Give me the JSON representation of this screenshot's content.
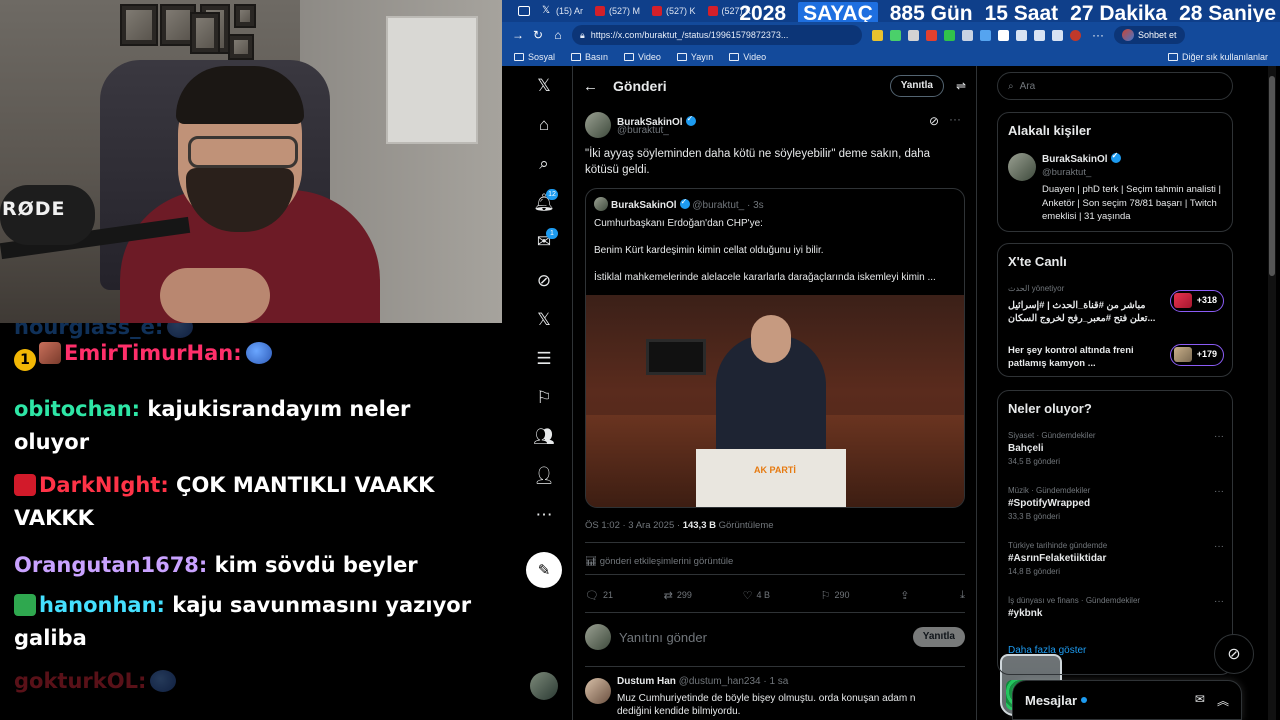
{
  "stream": {
    "mic_brand": "RØDE",
    "chat": [
      {
        "user": "hourglass_e:",
        "text": "",
        "color": "#2f8cff",
        "badges": [],
        "emote": true,
        "faded": true
      },
      {
        "user": "EmirTimurHan:",
        "text": "",
        "color": "#ff2f6a",
        "badges": [
          "num",
          "img"
        ],
        "badge_num": "1",
        "emote": true
      },
      {
        "user": "obitochan:",
        "text": "kajukisrandayım neler oluyor",
        "color": "#2ee6a6",
        "badges": []
      },
      {
        "user": "DarkNIght:",
        "text": "ÇOK MANTIKLI VAAKK VAKKK",
        "color": "#ff3347",
        "badges": [
          "red"
        ]
      },
      {
        "user": "Orangutan1678:",
        "text": "kim sövdü beyler",
        "color": "#c9a2ff",
        "badges": []
      },
      {
        "user": "hanonhan:",
        "text": "kaju savunmasını yazıyor galiba",
        "color": "#45e0ff",
        "badges": [
          "green"
        ]
      },
      {
        "user": "gokturkOL:",
        "text": "",
        "color": "#ff3347",
        "badges": [],
        "emote": true,
        "faded": true
      }
    ]
  },
  "browser": {
    "tabs": [
      {
        "label": "(15) Ar",
        "icon": "x-icon"
      },
      {
        "label": "(527) M",
        "icon": "youtube-icon"
      },
      {
        "label": "(527) K",
        "icon": "youtube-icon"
      },
      {
        "label": "(527) K",
        "icon": "youtube-icon"
      }
    ],
    "counter": {
      "year": "2028",
      "label": "SAYAÇ",
      "days": "885 Gün",
      "hours": "15 Saat",
      "minutes": "27 Dakika",
      "seconds": "28 Saniye"
    },
    "url": "https://x.com/buraktut_/status/19961579872373...",
    "chat_button": "Sohbet et",
    "bookmarks": [
      "Sosyal",
      "Basın",
      "Video",
      "Yayın",
      "Video"
    ],
    "other_bookmarks": "Diğer sık kullanılanlar"
  },
  "x": {
    "header": {
      "title": "Gönderi",
      "reply_button": "Yanıtla"
    },
    "nav_icons": [
      "x-logo-icon",
      "home-icon",
      "search-icon",
      "notifications-icon",
      "messages-icon",
      "grok-icon",
      "premium-icon",
      "lists-icon",
      "bookmarks-icon",
      "communities-icon",
      "profile-icon",
      "more-icon"
    ],
    "notif_count": "12",
    "msg_count": "1",
    "post": {
      "name": "BurakSakinOl",
      "handle": "@buraktut_",
      "text": "\"İki ayyaş söyleminden daha kötü ne söyleyebilir\" deme sakın, daha kötüsü geldi.",
      "quote": {
        "name": "BurakSakinOl",
        "handle": "@buraktut_",
        "time": "· 3s",
        "lines": [
          "Cumhurbaşkanı Erdoğan'dan CHP'ye:",
          "Benim Kürt kardeşimin kimin cellat olduğunu iyi bilir.",
          "İstiklal mahkemelerinde alelacele kararlarla darağaçlarında iskemleyi kimin ..."
        ],
        "image_logo": "AK PARTİ"
      },
      "time": "ÖS 1:02 · 3 Ara 2025 ·",
      "views": "143,3 B",
      "views_label": "Görüntüleme",
      "engagements": "gönderi etkileşimlerini görüntüle",
      "actions": {
        "replies": "21",
        "reposts": "299",
        "likes": "4 B",
        "bookmarks": "290"
      }
    },
    "reply_box": {
      "placeholder": "Yanıtını gönder",
      "button": "Yanıtla"
    },
    "reply": {
      "name": "Dustum Han",
      "handle": "@dustum_han234 · 1 sa",
      "text": "Muz Cumhuriyetinde de böyle bişey olmuştu. orda konuşan adam n dediğini kendide bilmiyordu."
    },
    "search_placeholder": "Ara",
    "related": {
      "title": "Alakalı kişiler",
      "name": "BurakSakinOl",
      "handle": "@buraktut_",
      "bio": "Duayen | phD terk | Seçim tahmin analisti | Anketör | Son seçim 78/81 başarı | Twitch emeklisi | 31 yaşında"
    },
    "live": {
      "title": "X'te Canlı",
      "items": [
        {
          "host": "الحدث",
          "sub": "yönetiyor",
          "title": "مباشر من #قناة_الحدث | #إسرائيل تعلن فتح #معبر_رفح لخروج السكان...",
          "count": "+318"
        },
        {
          "host": "",
          "sub": "",
          "title": "Her şey kontrol altında freni patlamış kamyon ...",
          "count": "+179"
        }
      ]
    },
    "trends": {
      "title": "Neler oluyor?",
      "items": [
        {
          "category": "Siyaset · Gündemdekiler",
          "name": "Bahçeli",
          "count": "34,5 B gönderi"
        },
        {
          "category": "Müzik · Gündemdekiler",
          "name": "#SpotifyWrapped",
          "count": "33,3 B gönderi"
        },
        {
          "category": "Türkiye tarihinde gündemde",
          "name": "#AsrınFelaketiiktidar",
          "count": "14,8 B gönderi"
        },
        {
          "category": "İş dünyası ve finans · Gündemdekiler",
          "name": "#ykbnk",
          "count": ""
        }
      ],
      "show_more": "Daha fazla göster"
    },
    "messages_drawer": {
      "title": "Mesajlar"
    },
    "colors": {
      "accent": "#1d9bf0",
      "border": "#2f3336",
      "muted": "#71767b"
    }
  }
}
